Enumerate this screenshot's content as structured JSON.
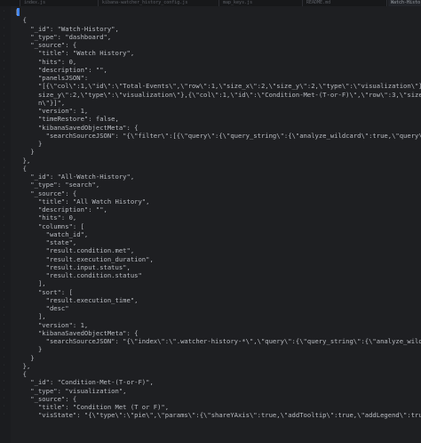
{
  "tabs": [
    {
      "label": "index.js",
      "active": false
    },
    {
      "label": "kibana-watcher_history_config.js",
      "active": false
    },
    {
      "label": "map_keys.js",
      "active": false
    },
    {
      "label": "README.md",
      "active": false
    },
    {
      "label": "Watch-History",
      "active": true
    }
  ],
  "code_lines": [
    "[",
    "  {",
    "    \"_id\": \"Watch-History\",",
    "    \"_type\": \"dashboard\",",
    "    \"_source\": {",
    "      \"title\": \"Watch History\",",
    "      \"hits\": 0,",
    "      \"description\": \"\",",
    "      \"panelsJSON\":",
    "      \"[{\\\"col\\\":1,\\\"id\\\":\\\"Total-Events\\\",\\\"row\\\":1,\\\"size_x\\\":2,\\\"size_y\\\":2,\\\"type\\\":\\\"visualization\\\"},{\\\"col\\\"",
    "      size_y\\\":2,\\\"type\\\":\\\"visualization\\\"},{\\\"col\\\":1,\\\"id\\\":\\\"Condition-Met-(T-or-F)\\\",\\\"row\\\":3,\\\"size_x\\\":2",
    "      n\\\"}]\",",
    "      \"version\": 1,",
    "      \"timeRestore\": false,",
    "      \"kibanaSavedObjectMeta\": {",
    "        \"searchSourceJSON\": \"{\\\"filter\\\":[{\\\"query\\\":{\\\"query_string\\\":{\\\"analyze_wildcard\\\":true,\\\"query\\\":\\\"*\\\"}}",
    "      }",
    "    }",
    "  },",
    "  {",
    "    \"_id\": \"All-Watch-History\",",
    "    \"_type\": \"search\",",
    "    \"_source\": {",
    "      \"title\": \"All Watch History\",",
    "      \"description\": \"\",",
    "      \"hits\": 0,",
    "      \"columns\": [",
    "        \"watch_id\",",
    "        \"state\",",
    "        \"result.condition.met\",",
    "        \"result.execution_duration\",",
    "        \"result.input.status\",",
    "        \"result.condition.status\"",
    "      ],",
    "      \"sort\": [",
    "        \"result.execution_time\",",
    "        \"desc\"",
    "      ],",
    "      \"version\": 1,",
    "      \"kibanaSavedObjectMeta\": {",
    "        \"searchSourceJSON\": \"{\\\"index\\\":\\\".watcher-history-*\\\",\\\"query\\\":{\\\"query_string\\\":{\\\"analyze_wildcard\\\":tr",
    "      }",
    "    }",
    "  },",
    "  {",
    "    \"_id\": \"Condition-Met-(T-or-F)\",",
    "    \"_type\": \"visualization\",",
    "    \"_source\": {",
    "      \"title\": \"Condition Met (T or F)\",",
    "      \"visState\": \"{\\\"type\\\":\\\"pie\\\",\\\"params\\\":{\\\"shareYAxis\\\":true,\\\"addTooltip\\\":true,\\\"addLegend\\\":true,\\\"isDon"
  ]
}
